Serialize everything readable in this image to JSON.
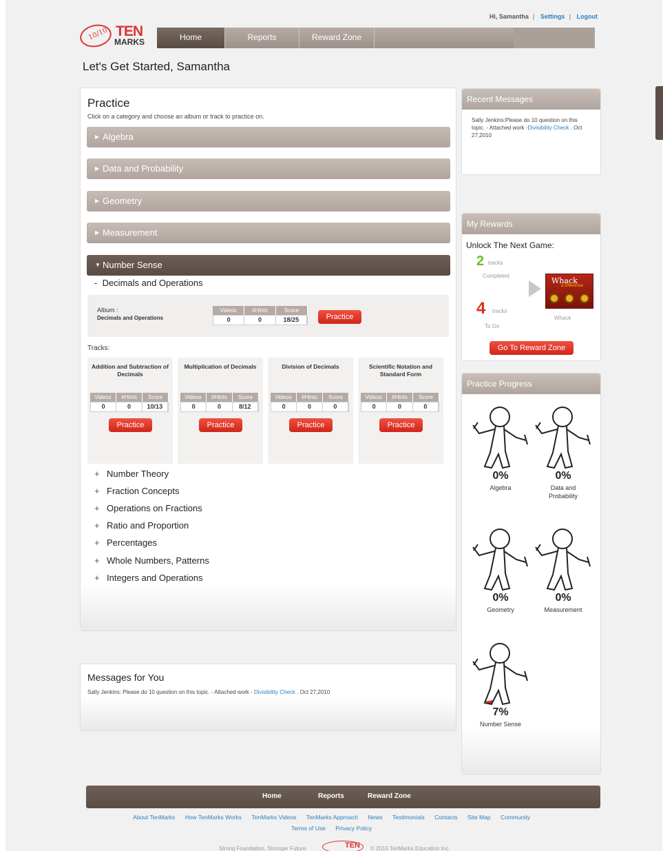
{
  "header": {
    "greeting": "Hi, Samantha",
    "settings": "Settings",
    "logout": "Logout",
    "logo_top": "TEN",
    "logo_bottom": "MARKS",
    "logo_mark": "10/10",
    "tabs": [
      "Home",
      "Reports",
      "Reward Zone"
    ]
  },
  "welcome": "Let's Get Started, Samantha",
  "practice": {
    "title": "Practice",
    "subtitle": "Click on a category and choose an album or track to practice on.",
    "categories": [
      "Algebra",
      "Data and Probability",
      "Geometry",
      "Measurement",
      "Number Sense"
    ],
    "open_category": "Number Sense",
    "subcategory": "Decimals and Operations",
    "album": {
      "label": "Album :",
      "name": "Decimals and Operations",
      "headers": [
        "Videos",
        "#Hints",
        "Score"
      ],
      "values": [
        "0",
        "0",
        "18/25"
      ],
      "button": "Practice"
    },
    "tracks_label": "Tracks:",
    "tracks": [
      {
        "title": "Addition and Subtraction of Decimals",
        "values": [
          "0",
          "0",
          "10/13"
        ],
        "button": "Practice"
      },
      {
        "title": "Multiplication of Decimals",
        "values": [
          "0",
          "0",
          "8/12"
        ],
        "button": "Practice"
      },
      {
        "title": "Division of Decimals",
        "values": [
          "0",
          "0",
          "0"
        ],
        "button": "Practice"
      },
      {
        "title": "Scientific Notation and Standard Form",
        "values": [
          "0",
          "0",
          "0"
        ],
        "button": "Practice"
      }
    ],
    "track_headers": [
      "Videos",
      "#Hints",
      "Score"
    ],
    "more_topics": [
      "Number Theory",
      "Fraction Concepts",
      "Operations on Fractions",
      "Ratio and Proportion",
      "Percentages",
      "Whole Numbers, Patterns",
      "Integers and Operations"
    ]
  },
  "recent_messages": {
    "title": "Recent Messages",
    "text": "Sally Jenkins:Please do 10 question on this topic. - Attached work",
    "link": "-Divisibility Check",
    "date": ". Oct 27,2010"
  },
  "rewards": {
    "title": "My Rewards",
    "unlock": "Unlock The Next Game:",
    "completed_num": "2",
    "completed_unit": "tracks",
    "completed_label": "Completed",
    "togo_num": "4",
    "togo_unit": "tracks",
    "togo_label": "To Go",
    "game_title": "Whack",
    "game_subtitle": "a Difference",
    "game_name": "Whack",
    "button": "Go To Reward Zone"
  },
  "progress": {
    "title": "Practice Progress",
    "items": [
      {
        "pct": "0%",
        "name": "Algebra"
      },
      {
        "pct": "0%",
        "name": "Data and Probability"
      },
      {
        "pct": "0%",
        "name": "Geometry"
      },
      {
        "pct": "0%",
        "name": "Measurement"
      },
      {
        "pct": "7%",
        "name": "Number Sense"
      }
    ]
  },
  "messages": {
    "title": "Messages for You",
    "text": "Sally Jenkins: Please do 10 question on this topic. - Attached work - ",
    "link": "Divisibility Check",
    "date": ". Oct 27,2010"
  },
  "footer": {
    "nav": [
      "Home",
      "Reports",
      "Reward Zone"
    ],
    "links": [
      "About TenMarks",
      "How TenMarks Works",
      "TenMarks Videos",
      "TenMarks Approach",
      "News",
      "Testimonials",
      "Contacts",
      "Site Map",
      "Community"
    ],
    "links2": [
      "Terms of Use",
      "Privacy Policy"
    ],
    "tagline": "Strong Foundation. Stronger Future.",
    "copyright": "© 2010 TenMarks Education Inc."
  },
  "colors": {
    "accent": "#d9301f",
    "brown": "#5e5048",
    "tan": "#b5aba4",
    "link": "#2b7fc0"
  }
}
